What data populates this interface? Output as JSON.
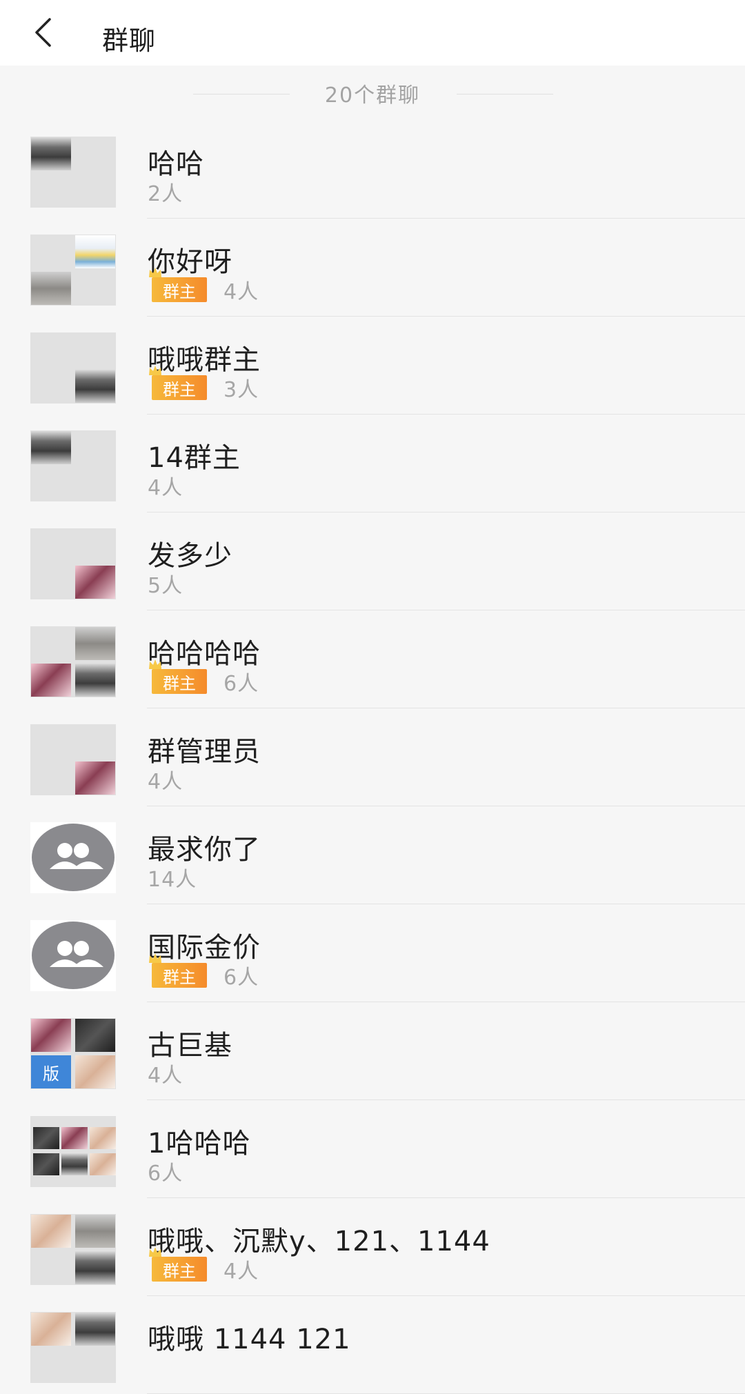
{
  "header": {
    "title": "群聊"
  },
  "group_count": "20个群聊",
  "groups": [
    {
      "name": "哈哈",
      "owner": false,
      "members": "2人"
    },
    {
      "name": "你好呀",
      "owner": true,
      "members": "4人"
    },
    {
      "name": "哦哦群主",
      "owner": true,
      "members": "3人"
    },
    {
      "name": "14群主",
      "owner": false,
      "members": "4人"
    },
    {
      "name": "发多少",
      "owner": false,
      "members": "5人"
    },
    {
      "name": "哈哈哈哈",
      "owner": true,
      "members": "6人"
    },
    {
      "name": "群管理员",
      "owner": false,
      "members": "4人"
    },
    {
      "name": "最求你了",
      "owner": false,
      "members": "14人"
    },
    {
      "name": "国际金价",
      "owner": true,
      "members": "6人"
    },
    {
      "name": "古巨基",
      "owner": false,
      "members": "4人"
    },
    {
      "name": "1哈哈哈",
      "owner": false,
      "members": "6人"
    },
    {
      "name": "哦哦、沉默y、121、1144",
      "owner": true,
      "members": "4人"
    },
    {
      "name": "哦哦 1144 121",
      "owner": false,
      "members": ""
    }
  ],
  "owner_badge_label": "群主",
  "version_tile_label": "版",
  "colors": {
    "badge_start": "#f6b93b",
    "badge_end": "#f58b2b",
    "group_icon_bg": "#8a8a8e",
    "version_tile": "#3f86d8"
  }
}
